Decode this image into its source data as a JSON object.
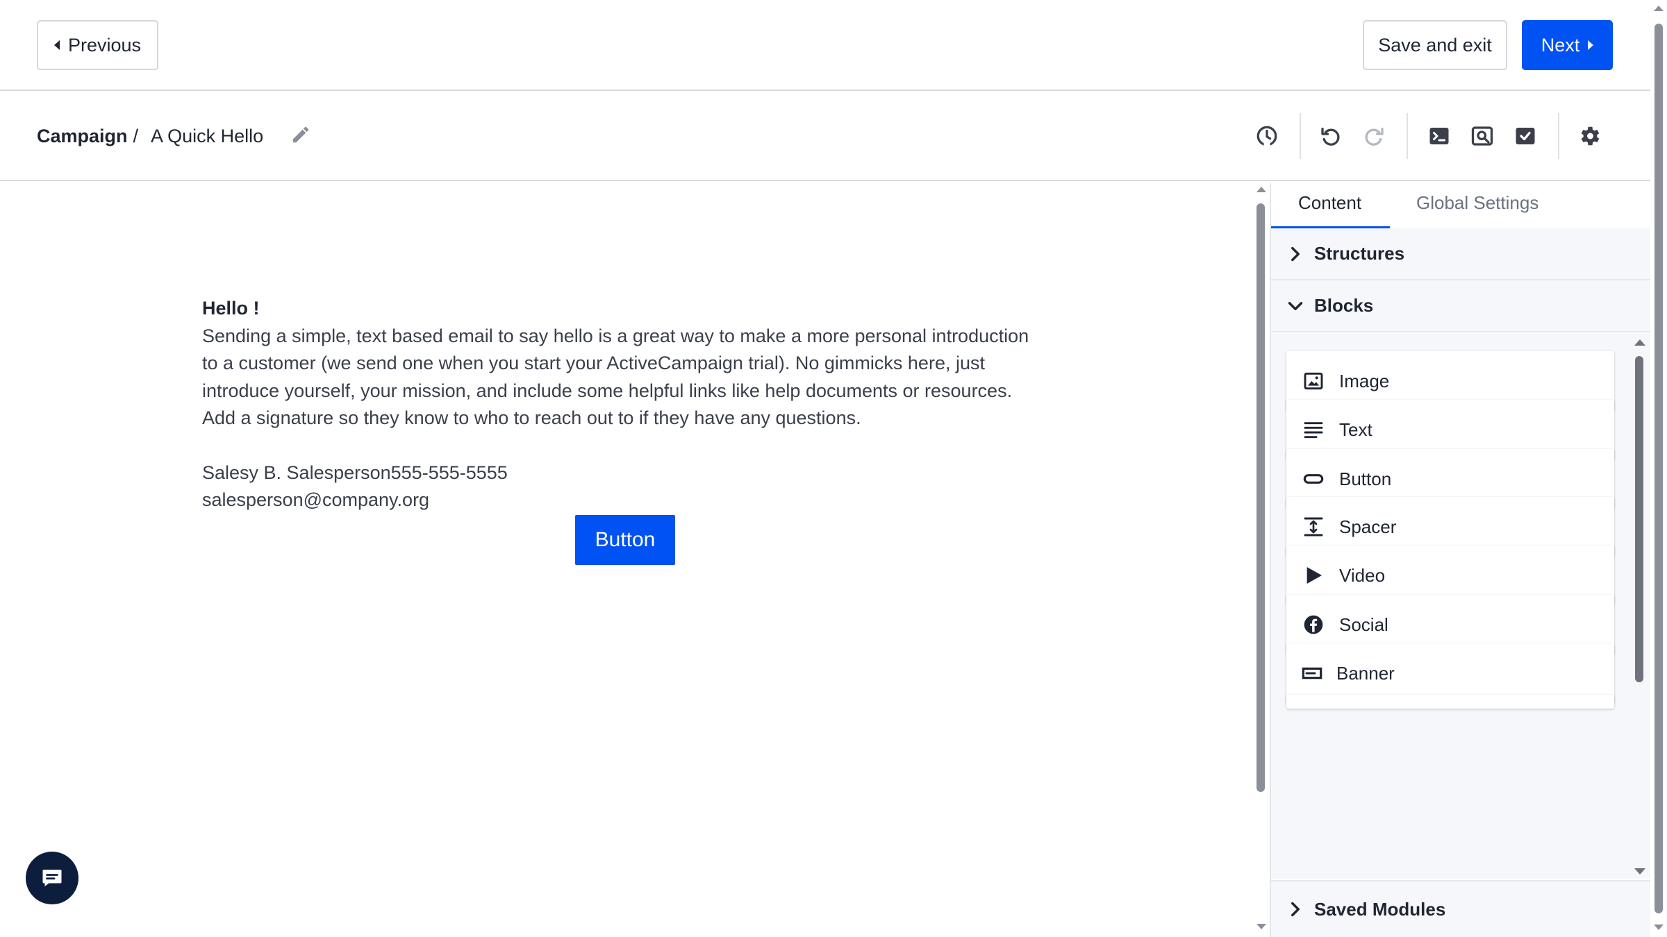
{
  "topbar": {
    "previous_label": "Previous",
    "save_exit_label": "Save and exit",
    "next_label": "Next"
  },
  "breadcrumb": {
    "root": "Campaign",
    "separator": "/",
    "title": "A Quick Hello"
  },
  "toolbar": {
    "icons": [
      "history-icon",
      "undo-icon",
      "redo-icon",
      "code-icon",
      "preview-icon",
      "test-icon",
      "settings-icon"
    ]
  },
  "email": {
    "greeting": "Hello !",
    "body_lines": [
      "Sending a simple, text based email to say hello is a great way to make a more personal introduction",
      "to a customer (we send one when you start your ActiveCampaign trial). No gimmicks here, just",
      "introduce yourself, your mission, and include some helpful links like help documents or resources.",
      "Add a signature so they know to who to reach out to if they have any questions."
    ],
    "signature_line1": "Salesy B. Salesperson555-555-5555",
    "signature_line2": "salesperson@company.org",
    "button_label": "Button"
  },
  "panel": {
    "tabs": [
      {
        "label": "Content",
        "active": true
      },
      {
        "label": "Global Settings",
        "active": false
      }
    ],
    "sections": {
      "structures": "Structures",
      "blocks": "Blocks",
      "saved_modules": "Saved Modules"
    },
    "blocks": [
      {
        "label": "Image",
        "icon": "image-icon"
      },
      {
        "label": "Text",
        "icon": "text-icon"
      },
      {
        "label": "Button",
        "icon": "button-icon"
      },
      {
        "label": "Spacer",
        "icon": "spacer-icon"
      },
      {
        "label": "Video",
        "icon": "video-icon"
      },
      {
        "label": "Social",
        "icon": "social-icon"
      },
      {
        "label": "Banner",
        "icon": "banner-icon"
      }
    ]
  },
  "colors": {
    "primary": "#0052f2",
    "text": "#1f2532",
    "chat_button": "#0c1e3c",
    "panel_bg": "#f5f7fa"
  }
}
